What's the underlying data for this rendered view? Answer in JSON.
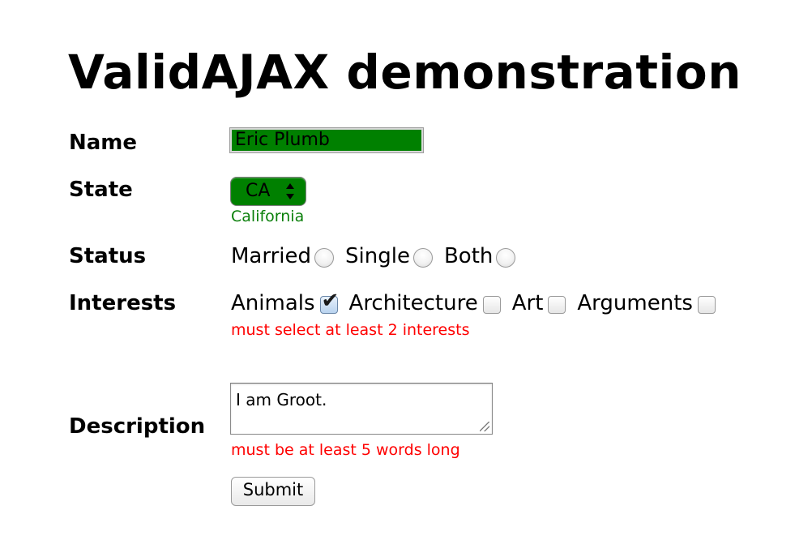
{
  "page": {
    "title": "ValidAJAX demonstration"
  },
  "form": {
    "name": {
      "label": "Name",
      "value": "Eric Plumb",
      "field_color": "#008000"
    },
    "state": {
      "label": "State",
      "selected": "CA",
      "hint": "California",
      "hint_color": "#0a7f0a",
      "field_color": "#008000"
    },
    "status": {
      "label": "Status",
      "options": [
        {
          "label": "Married",
          "checked": false
        },
        {
          "label": "Single",
          "checked": false
        },
        {
          "label": "Both",
          "checked": false
        }
      ]
    },
    "interests": {
      "label": "Interests",
      "options": [
        {
          "label": "Animals",
          "checked": true
        },
        {
          "label": "Architecture",
          "checked": false
        },
        {
          "label": "Art",
          "checked": false
        },
        {
          "label": "Arguments",
          "checked": false
        }
      ],
      "error": "must select at least 2 interests",
      "error_color": "#ff0000"
    },
    "description": {
      "label": "Description",
      "value": "I am Groot.",
      "error": "must be at least 5 words long",
      "error_color": "#ff0000"
    },
    "submit_label": "Submit"
  }
}
